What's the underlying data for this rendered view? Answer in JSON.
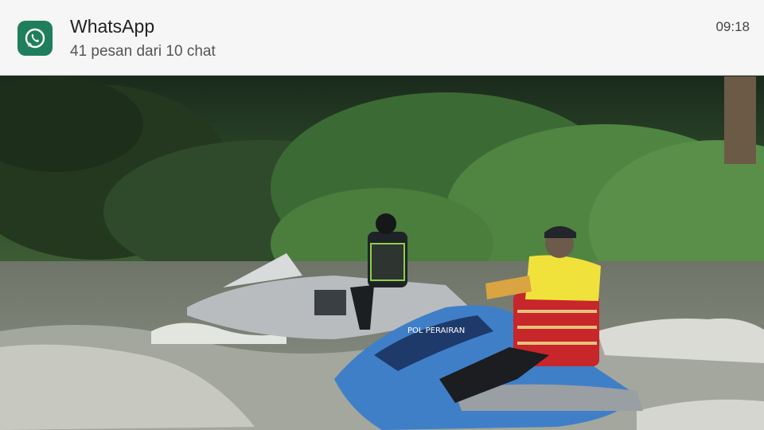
{
  "notification": {
    "app_name": "WhatsApp",
    "summary": "41 pesan dari 10 chat",
    "time": "09:18",
    "icon": "whatsapp-icon",
    "accent": "#1f7e5c"
  },
  "video": {
    "jetski_label": "POL PERAIRAN"
  }
}
